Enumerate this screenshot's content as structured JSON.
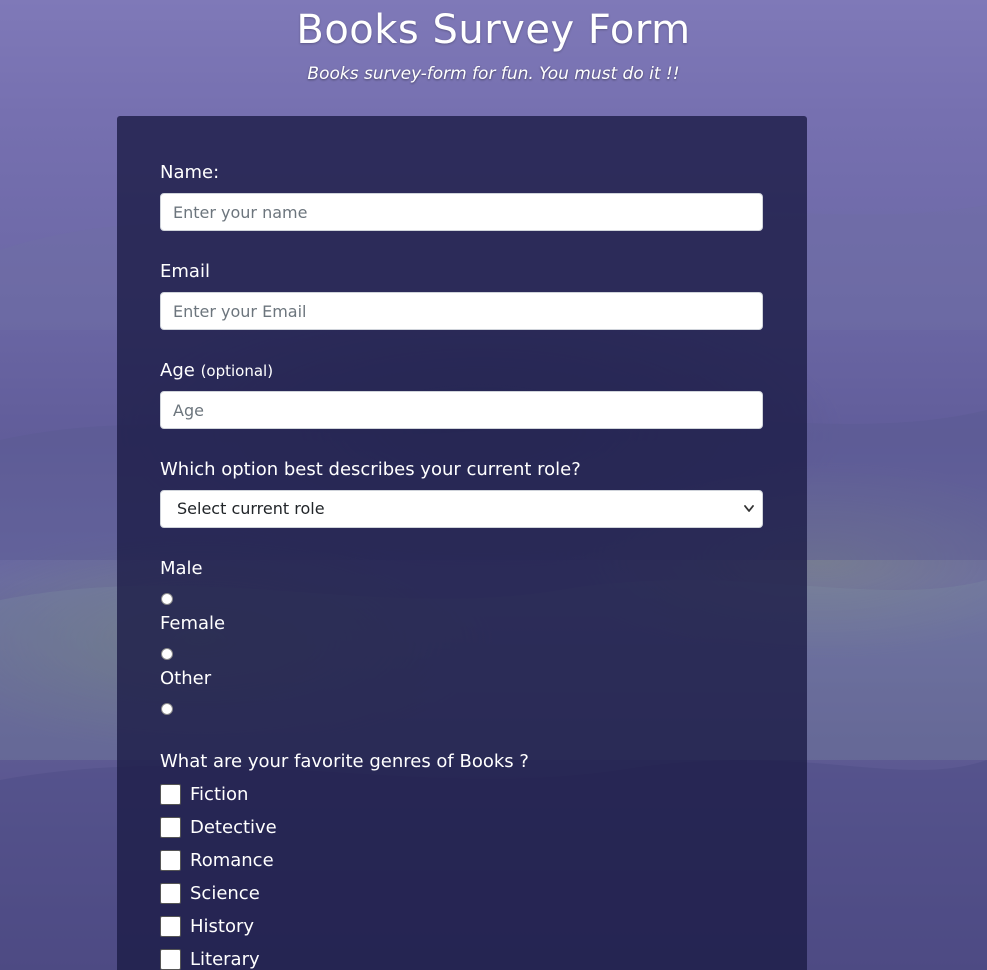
{
  "header": {
    "title": "Books Survey Form",
    "subtitle": "Books survey-form for fun. You must do it !!"
  },
  "form": {
    "name": {
      "label": "Name:",
      "placeholder": "Enter your name"
    },
    "email": {
      "label": "Email",
      "placeholder": "Enter your Email"
    },
    "age": {
      "label": "Age",
      "label_note": "(optional)",
      "placeholder": "Age"
    },
    "role": {
      "label": "Which option best describes your current role?",
      "selected": "Select current role"
    },
    "gender": {
      "options": [
        "Male",
        "Female",
        "Other"
      ]
    },
    "genres": {
      "label": "What are your favorite genres of Books ?",
      "options": [
        "Fiction",
        "Detective",
        "Romance",
        "Science",
        "History",
        "Literary"
      ]
    }
  },
  "colors": {
    "panel": "#1b1c46",
    "background": "#6c68a6",
    "input_background": "#ffffff"
  },
  "icons": {
    "select_arrow": "chevron-down-icon"
  }
}
